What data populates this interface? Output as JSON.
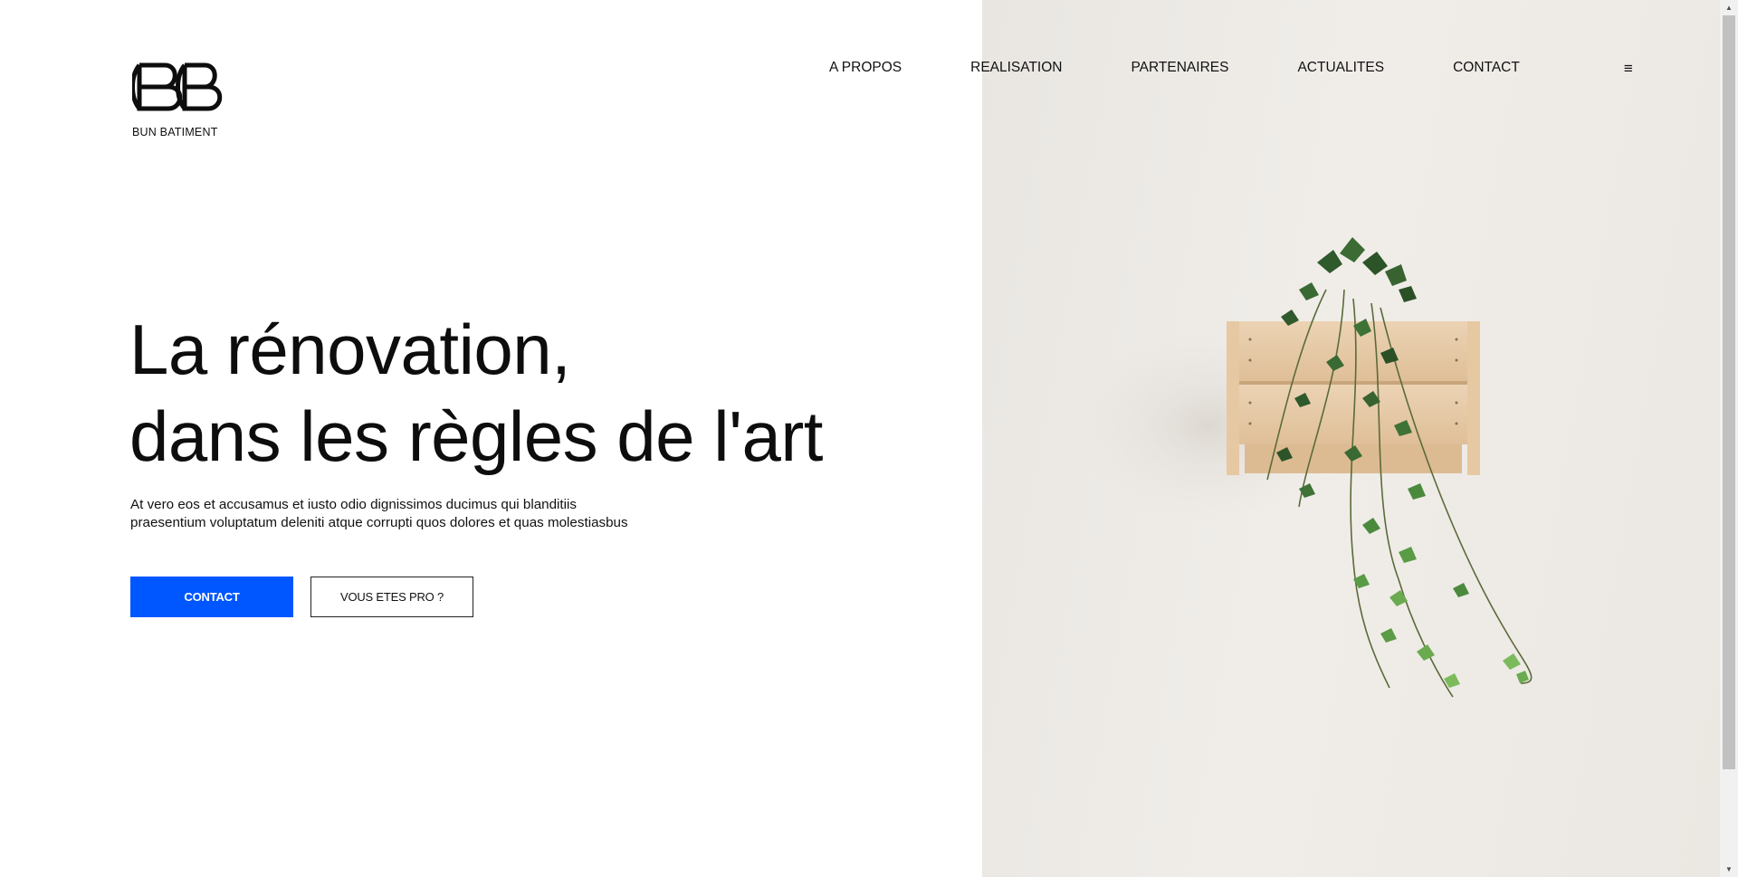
{
  "brand": {
    "logo_mark": "BB",
    "name": "BUN BATIMENT"
  },
  "nav": {
    "items": [
      {
        "label": "A PROPOS"
      },
      {
        "label": "REALISATION"
      },
      {
        "label": "PARTENAIRES"
      },
      {
        "label": "ACTUALITES"
      },
      {
        "label": "CONTACT"
      }
    ],
    "menu_icon": "≡"
  },
  "hero": {
    "headline_line1": "La rénovation,",
    "headline_line2": "dans les règles de l'art",
    "lead_line1": "At vero eos et accusamus et iusto odio dignissimos ducimus qui blanditiis",
    "lead_line2": "praesentium voluptatum deleniti atque corrupti quos dolores et quas molestiasbus",
    "primary_button": "CONTACT",
    "secondary_button": "VOUS ETES PRO ?",
    "image": "plant-in-wooden-crate-on-wall"
  },
  "colors": {
    "accent": "#0057ff",
    "text": "#111111",
    "image_background": "#ece9e5"
  },
  "icons": {
    "menu": "hamburger-menu-icon",
    "scroll_up": "scroll-up-arrow-icon",
    "scroll_down": "scroll-down-arrow-icon"
  }
}
